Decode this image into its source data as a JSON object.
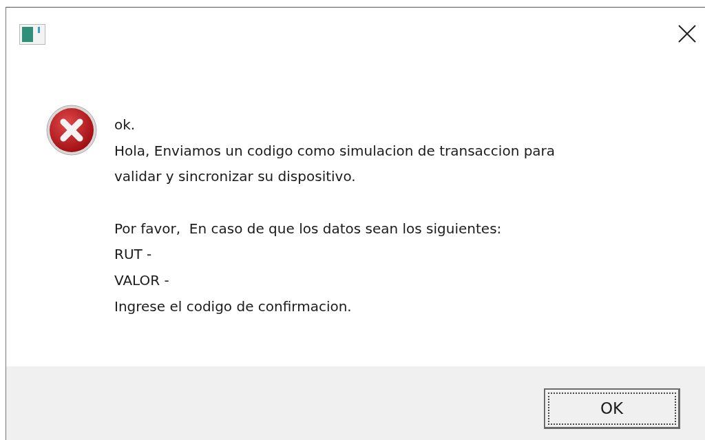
{
  "message": {
    "paragraphs": [
      [
        "ok.",
        "Hola, Enviamos un codigo como simulacion de transaccion para",
        "validar y sincronizar su dispositivo."
      ],
      [
        "Por favor,  En caso de que los datos sean los siguientes:",
        "RUT -",
        "VALOR -",
        "Ingrese el codigo de confirmacion."
      ]
    ]
  },
  "buttons": [
    {
      "label": "OK",
      "focused": true
    }
  ]
}
